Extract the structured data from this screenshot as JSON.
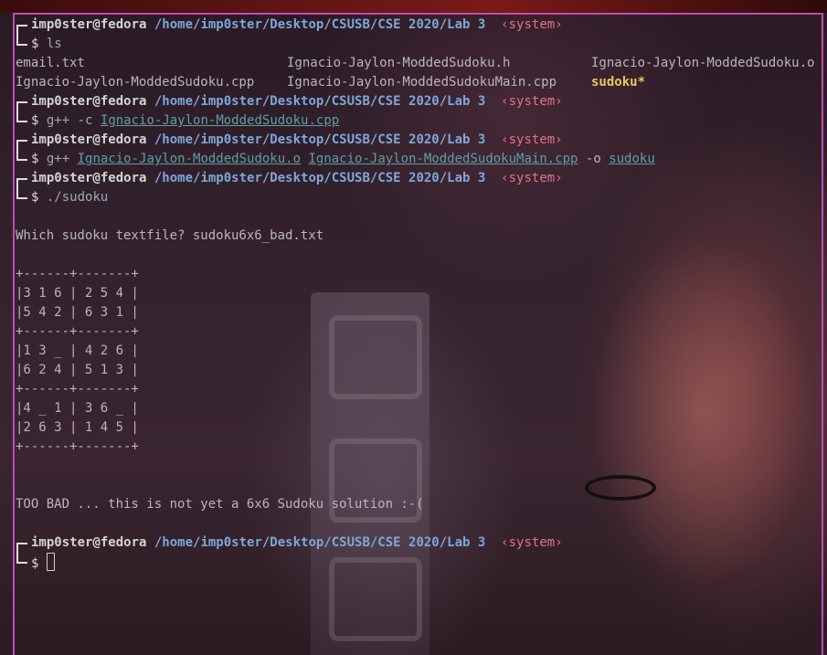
{
  "prompt": {
    "user": "imp0ster@fedora",
    "path": "/home/imp0ster/Desktop/CSUSB/CSE 2020/Lab 3",
    "context": "‹system›",
    "symbol": "$"
  },
  "commands": {
    "c1": "ls",
    "c2_cmd": "g++ -c ",
    "c2_file": "Ignacio-Jaylon-ModdedSudoku.cpp",
    "c3_cmd": "g++ ",
    "c3_obj": "Ignacio-Jaylon-ModdedSudoku.o",
    "c3_main": "Ignacio-Jaylon-ModdedSudokuMain.cpp",
    "c3_flag": " -o ",
    "c3_out": "sudoku",
    "c4": "./sudoku"
  },
  "ls_output": {
    "row1": [
      "email.txt",
      "Ignacio-Jaylon-ModdedSudoku.h",
      "Ignacio-Jaylon-ModdedSudoku.o"
    ],
    "row2": [
      "Ignacio-Jaylon-ModdedSudoku.cpp",
      "Ignacio-Jaylon-ModdedSudokuMain.cpp",
      "sudoku*"
    ]
  },
  "program_output": {
    "question": "Which sudoku textfile? sudoku6x6_bad.txt",
    "board": [
      "+------+-------+",
      "|3 1 6 | 2 5 4 |",
      "|5 4 2 | 6 3 1 |",
      "+------+-------+",
      "|1 3 _ | 4 2 6 |",
      "|6 2 4 | 5 1 3 |",
      "+------+-------+",
      "|4 _ 1 | 3 6 _ |",
      "|2 6 3 | 1 4 5 |",
      "+------+-------+"
    ],
    "verdict": "TOO BAD ... this is not yet a 6x6 Sudoku solution :-("
  }
}
